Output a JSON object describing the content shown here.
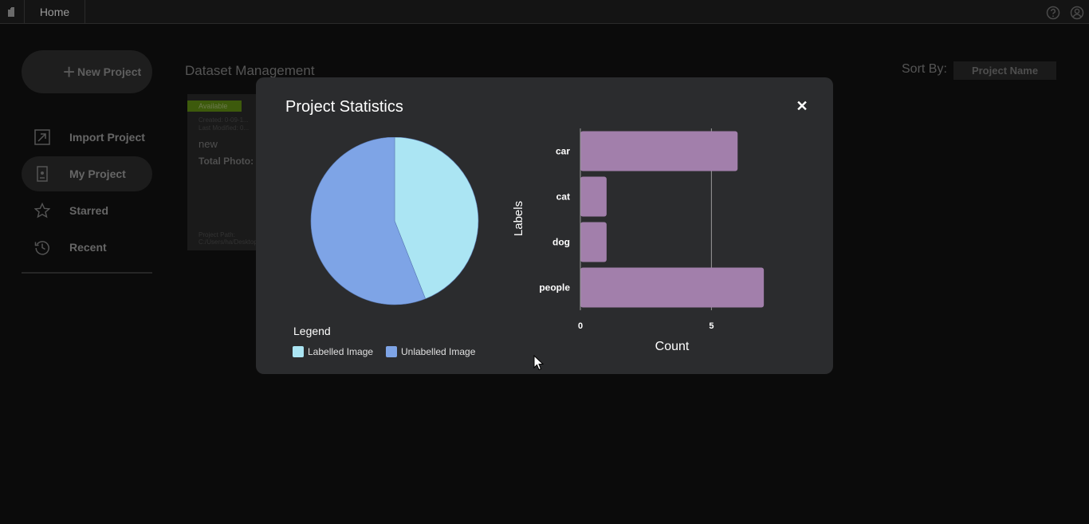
{
  "topbar": {
    "home_tab": "Home"
  },
  "sidebar": {
    "new_project": "New Project",
    "items": [
      {
        "label": "Import Project",
        "icon": "import-icon"
      },
      {
        "label": "My Project",
        "icon": "project-icon",
        "active": true
      },
      {
        "label": "Starred",
        "icon": "star-icon"
      },
      {
        "label": "Recent",
        "icon": "history-icon"
      }
    ]
  },
  "main": {
    "section_title": "Dataset Management",
    "sort_label": "Sort By:",
    "sort_value": "Project Name",
    "project_card": {
      "status": "Available",
      "created": "Created: 0-09-1...",
      "modified": "Last Modified: 0...",
      "name": "new",
      "total_photo": "Total Photo:",
      "path_label": "Project Path:",
      "path_value": "C:/Users/ha/Desktop..."
    }
  },
  "modal": {
    "title": "Project Statistics",
    "close": "✕",
    "legend_title": "Legend",
    "legend_items": [
      {
        "label": "Labelled Image",
        "color": "#abe5f3"
      },
      {
        "label": "Unlabelled Image",
        "color": "#7ea4e6"
      }
    ]
  },
  "chart_data": [
    {
      "type": "pie",
      "labels": [
        "Labelled Image",
        "Unlabelled Image"
      ],
      "values": [
        44,
        56
      ],
      "colors": [
        "#abe5f3",
        "#7ea4e6"
      ]
    },
    {
      "type": "bar",
      "orientation": "horizontal",
      "categories": [
        "car",
        "cat",
        "dog",
        "people"
      ],
      "values": [
        6,
        1,
        1,
        7
      ],
      "xlabel": "Count",
      "ylabel": "Labels",
      "xticks": [
        0,
        5
      ],
      "xlim": [
        0,
        8
      ],
      "grid": true,
      "bar_color": "#a27fab"
    }
  ]
}
